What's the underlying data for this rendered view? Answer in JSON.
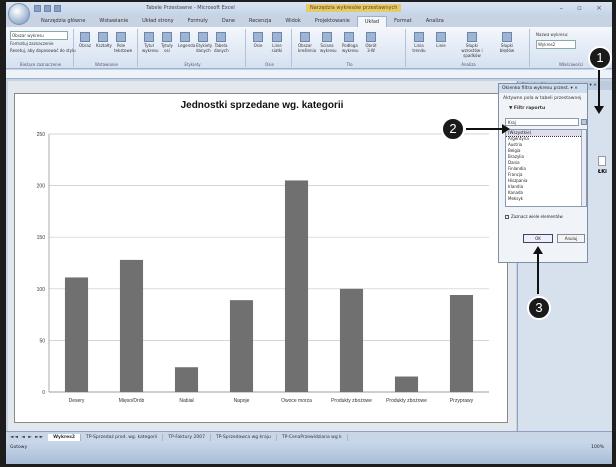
{
  "window": {
    "title": "Tabele Przestawne - Microsoft Excel",
    "context_title": "Narzędzia wykresów przestawnych",
    "controls": "– ▫ ×"
  },
  "ribbon_tabs": [
    "Narzędzia główne",
    "Wstawianie",
    "Układ strony",
    "Formuły",
    "Dane",
    "Recenzja",
    "Widok",
    "Projektowanie",
    "Układ",
    "Format",
    "Analiza"
  ],
  "selected_tab_index": 8,
  "ribbon": {
    "chart_elements_label": "Obszar wykresu",
    "format_selection": "Formatuj zaznaczenie",
    "reset_style": "Resetuj, aby dopasować do stylu",
    "group_current": "Bieżące zaznaczenie",
    "group_insert": "Wstawianie",
    "group_labels": "Etykiety",
    "group_axes": "Osie",
    "group_background": "Tło",
    "group_analysis": "Analiza",
    "group_properties": "Właściwości",
    "chart_name_label": "Nazwa wykresu:",
    "chart_name_value": "Wykres2",
    "buttons": [
      "Obraz",
      "Kształty",
      "Pole tekstowe",
      "Tytuł wykresu",
      "Tytuły osi",
      "Legenda",
      "Etykiety danych",
      "Tabela danych",
      "Osie",
      "Linie siatki",
      "Obszar kreślenia",
      "Ściana wykresu",
      "Podłoga wykresu",
      "Obrót 3-W",
      "Linia trendu",
      "Linie",
      "Słupki wzrostów i spadków",
      "Słupki błędów"
    ]
  },
  "chart_data": {
    "type": "bar",
    "title": "Jednostki sprzedane wg. kategorii",
    "categories": [
      "Desery",
      "Mięso/Drób",
      "Nabiał",
      "Napoje",
      "Owoce morza",
      "Produkty zbożowe",
      "Produkty zbożowe",
      "Przyprawy"
    ],
    "values": [
      111,
      128,
      24,
      89,
      205,
      100,
      15,
      94
    ],
    "ylim": [
      0,
      250
    ],
    "yticks": [
      0,
      50,
      100,
      150,
      200,
      250
    ],
    "bar_color": "#707070",
    "grid": true
  },
  "pane": {
    "header": "Okienko filtra wykresu przest. ▾ ×",
    "dialog_title": "Okienko filtra wykresu przest. ▾ ×",
    "active_fields": "Aktywne pola w tabeli przestawnej",
    "filter_label": "Filtr raportu",
    "search_value": "Kraj",
    "list_items": [
      "(Wszystkie)",
      "Argentyna",
      "Austria",
      "Belgia",
      "Brazylia",
      "Dania",
      "Finlandia",
      "Francja",
      "Hiszpania",
      "Irlandia",
      "Kanada",
      "Meksyk"
    ],
    "selected_item_index": 0,
    "multi_select_label": "Zaznacz wiele elementów",
    "ok_label": "OK",
    "cancel_label": "Anuluj",
    "side_label": "ŁKi"
  },
  "sheet_tabs": {
    "nav": "◄◄ ◄ ► ►►",
    "tabs": [
      "Wykres2",
      "TP-Sprzedaż prod. wg. kategorii",
      "TP-Faktury 2007",
      "TP-Sprzedawca wg kraju",
      "TP-CenaPrzewidziana wg k"
    ],
    "selected_index": 0
  },
  "status": {
    "left": "Gotowy",
    "right": "100%"
  },
  "callouts": [
    "1",
    "2",
    "3"
  ]
}
